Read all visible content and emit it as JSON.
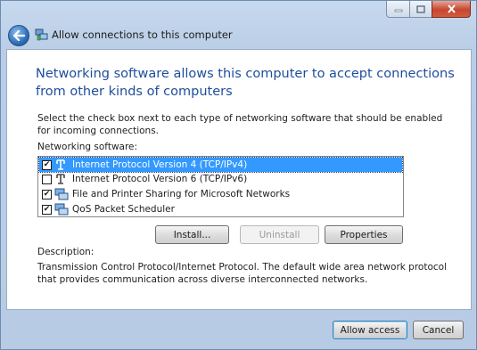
{
  "window": {
    "title": "Allow connections to this computer"
  },
  "content": {
    "main_instruction": "Networking software allows this computer to accept connections from other kinds of computers",
    "instructions": "Select the check box next to each type of networking software that should be enabled for incoming connections.",
    "list_label": "Networking software:",
    "items": [
      {
        "label": "Internet Protocol Version 4 (TCP/IPv4)",
        "checked": true,
        "selected": true,
        "icon": "protocol-icon"
      },
      {
        "label": "Internet Protocol Version 6 (TCP/IPv6)",
        "checked": false,
        "selected": false,
        "icon": "protocol-icon"
      },
      {
        "label": "File and Printer Sharing for Microsoft Networks",
        "checked": true,
        "selected": false,
        "icon": "service-icon"
      },
      {
        "label": "QoS Packet Scheduler",
        "checked": true,
        "selected": false,
        "icon": "service-icon"
      }
    ],
    "buttons": {
      "install": "Install...",
      "uninstall": "Uninstall",
      "properties": "Properties"
    },
    "description_label": "Description:",
    "description_text": "Transmission Control Protocol/Internet Protocol. The default wide area network protocol that provides communication across diverse interconnected networks."
  },
  "footer": {
    "allow_access": "Allow access",
    "cancel": "Cancel"
  }
}
